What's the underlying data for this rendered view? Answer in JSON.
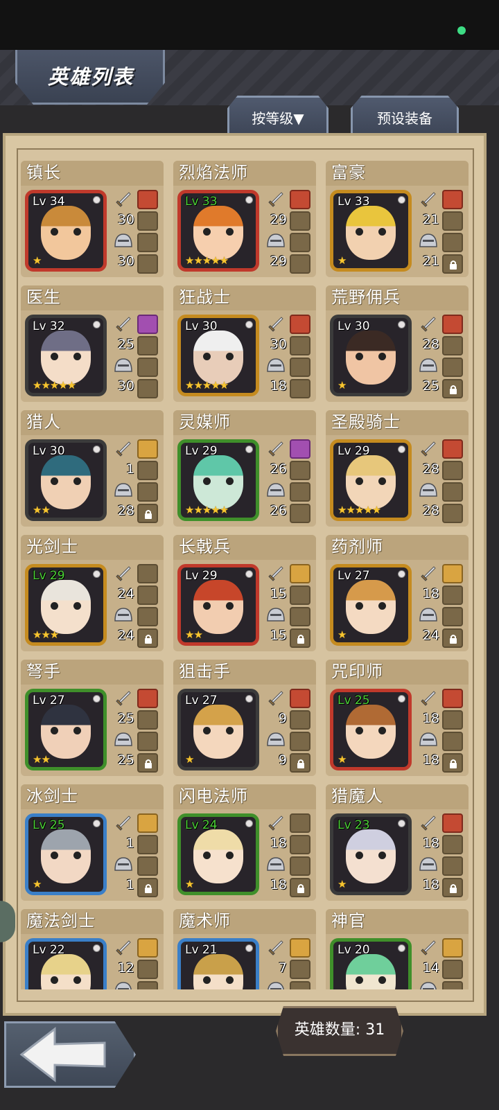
{
  "header": {
    "title": "英雄列表"
  },
  "tabs": {
    "sort_label": "按等级▼",
    "preset_label": "预设装备"
  },
  "footer": {
    "hero_count_label": "英雄数量: 31"
  },
  "heroes": [
    {
      "name": "镇长",
      "level": "Lv 34",
      "level_green": false,
      "atk": "30",
      "def": "30",
      "stars": "★",
      "frame": "#c0392b",
      "skin": "#f2c79c",
      "hair": "#c98a3a",
      "slot_top": "equip",
      "lock": false
    },
    {
      "name": "烈焰法师",
      "level": "Lv 33",
      "level_green": true,
      "atk": "29",
      "def": "29",
      "stars": "★★★★★",
      "frame": "#c0392b",
      "skin": "#f6cfae",
      "hair": "#e07a2b",
      "slot_top": "equip",
      "lock": false
    },
    {
      "name": "富豪",
      "level": "Lv 33",
      "level_green": false,
      "atk": "21",
      "def": "21",
      "stars": "★",
      "frame": "#c58b1f",
      "skin": "#f2d1b0",
      "hair": "#e9c53d",
      "slot_top": "equip",
      "lock": true
    },
    {
      "name": "医生",
      "level": "Lv 32",
      "level_green": false,
      "atk": "25",
      "def": "30",
      "stars": "★★★★★",
      "frame": "#3b3b3b",
      "skin": "#f4ddc8",
      "hair": "#6f6e86",
      "slot_top": "equip purple",
      "lock": false
    },
    {
      "name": "狂战士",
      "level": "Lv 30",
      "level_green": false,
      "atk": "30",
      "def": "18",
      "stars": "★★★★★",
      "frame": "#c58b1f",
      "skin": "#e8cdb9",
      "hair": "#efefef",
      "slot_top": "equip",
      "lock": false
    },
    {
      "name": "荒野佣兵",
      "level": "Lv 30",
      "level_green": false,
      "atk": "28",
      "def": "25",
      "stars": "★",
      "frame": "#3b3b3b",
      "skin": "#f0c5a4",
      "hair": "#3b2a24",
      "slot_top": "equip",
      "lock": true
    },
    {
      "name": "猎人",
      "level": "Lv 30",
      "level_green": false,
      "atk": "1",
      "def": "28",
      "stars": "★★",
      "frame": "#3b3b3b",
      "skin": "#f0d0b4",
      "hair": "#2f6b7d",
      "slot_top": "equip gold",
      "lock": true
    },
    {
      "name": "灵媒师",
      "level": "Lv 29",
      "level_green": false,
      "atk": "26",
      "def": "26",
      "stars": "★★★★★",
      "frame": "#3f8f2a",
      "skin": "#cde8d7",
      "hair": "#5fc7a8",
      "slot_top": "equip purple",
      "lock": false
    },
    {
      "name": "圣殿骑士",
      "level": "Lv 29",
      "level_green": false,
      "atk": "28",
      "def": "28",
      "stars": "★★★★★",
      "frame": "#c58b1f",
      "skin": "#f2d6b8",
      "hair": "#e7c77b",
      "slot_top": "equip",
      "lock": false
    },
    {
      "name": "光剑士",
      "level": "Lv 29",
      "level_green": true,
      "atk": "24",
      "def": "24",
      "stars": "★★★",
      "frame": "#c58b1f",
      "skin": "#f4e0cc",
      "hair": "#e9e4dc",
      "slot_top": "",
      "lock": true
    },
    {
      "name": "长戟兵",
      "level": "Lv 29",
      "level_green": false,
      "atk": "15",
      "def": "15",
      "stars": "★★",
      "frame": "#c0392b",
      "skin": "#f2cdb0",
      "hair": "#c7462a",
      "slot_top": "equip gold",
      "lock": true
    },
    {
      "name": "药剂师",
      "level": "Lv 27",
      "level_green": false,
      "atk": "18",
      "def": "24",
      "stars": "★",
      "frame": "#c58b1f",
      "skin": "#f4dac2",
      "hair": "#d69a4b",
      "slot_top": "equip gold",
      "lock": true
    },
    {
      "name": "弩手",
      "level": "Lv 27",
      "level_green": false,
      "atk": "25",
      "def": "25",
      "stars": "★★",
      "frame": "#3f8f2a",
      "skin": "#f0d0b8",
      "hair": "#2f3340",
      "slot_top": "equip",
      "lock": true
    },
    {
      "name": "狙击手",
      "level": "Lv 27",
      "level_green": false,
      "atk": "9",
      "def": "9",
      "stars": "★",
      "frame": "#3b3b3b",
      "skin": "#f4d7bd",
      "hair": "#d4a24a",
      "slot_top": "equip",
      "lock": true
    },
    {
      "name": "咒印师",
      "level": "Lv 25",
      "level_green": true,
      "atk": "18",
      "def": "18",
      "stars": "★",
      "frame": "#c0392b",
      "skin": "#f4d7bd",
      "hair": "#b06a34",
      "slot_top": "equip",
      "lock": true
    },
    {
      "name": "冰剑士",
      "level": "Lv 25",
      "level_green": true,
      "atk": "1",
      "def": "1",
      "stars": "★",
      "frame": "#3a7fc8",
      "skin": "#f2d8c4",
      "hair": "#9da4ad",
      "slot_top": "equip gold",
      "lock": true
    },
    {
      "name": "闪电法师",
      "level": "Lv 24",
      "level_green": true,
      "atk": "18",
      "def": "18",
      "stars": "★",
      "frame": "#3f8f2a",
      "skin": "#f6e1cd",
      "hair": "#efdca8",
      "slot_top": "",
      "lock": true
    },
    {
      "name": "猎魔人",
      "level": "Lv 23",
      "level_green": true,
      "atk": "18",
      "def": "18",
      "stars": "★",
      "frame": "#3b3b3b",
      "skin": "#f4e0d0",
      "hair": "#cfcfe0",
      "slot_top": "equip",
      "lock": true
    },
    {
      "name": "魔法剑士",
      "level": "Lv 22",
      "level_green": false,
      "atk": "12",
      "def": "",
      "stars": "",
      "frame": "#3a7fc8",
      "skin": "#f4dfc8",
      "hair": "#e7d28a",
      "slot_top": "equip gold",
      "lock": false
    },
    {
      "name": "魔术师",
      "level": "Lv 21",
      "level_green": false,
      "atk": "7",
      "def": "",
      "stars": "",
      "frame": "#3a7fc8",
      "skin": "#f4dfc8",
      "hair": "#c9a04a",
      "slot_top": "equip gold",
      "lock": false
    },
    {
      "name": "神官",
      "level": "Lv 20",
      "level_green": false,
      "atk": "14",
      "def": "",
      "stars": "",
      "frame": "#3f8f2a",
      "skin": "#f0e6d0",
      "hair": "#6fcf9b",
      "slot_top": "equip gold",
      "lock": false
    }
  ]
}
